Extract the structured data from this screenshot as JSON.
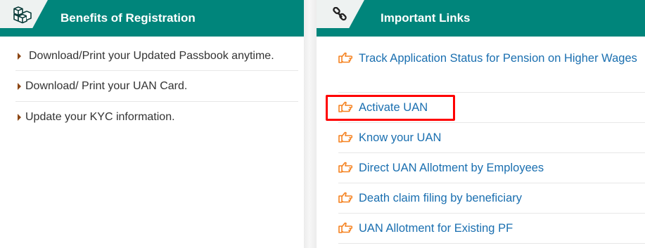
{
  "benefits": {
    "title": "Benefits of Registration",
    "items": [
      "Download/Print your Updated Passbook anytime.",
      "Download/ Print your UAN Card.",
      "Update your KYC information."
    ]
  },
  "links": {
    "title": "Important Links",
    "items": [
      "Track Application Status for Pension on Higher Wages",
      "Activate UAN",
      "Know your UAN",
      "Direct UAN Allotment by Employees",
      "Death claim filing by beneficiary",
      "UAN Allotment for Existing PF"
    ],
    "highlighted_item": "Activate UAN"
  },
  "colors": {
    "header_bg": "#00857b",
    "link": "#1a6fb0",
    "hand_icon": "#f58220",
    "highlight_border": "#ff0000",
    "bullet": "#8b4513"
  },
  "icons": {
    "benefits_header": "boxes-icon",
    "links_header": "link-icon",
    "link_item": "hand-pointing-right-icon",
    "benefit_item": "triangle-bullet-icon"
  }
}
